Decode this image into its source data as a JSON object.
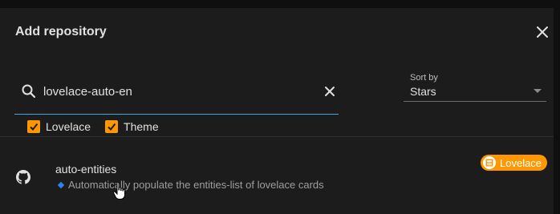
{
  "dialog": {
    "title": "Add repository",
    "close_icon": "close-icon"
  },
  "search": {
    "icon": "search-icon",
    "value": "lovelace-auto-en",
    "clear_icon": "close-icon"
  },
  "sort": {
    "label": "Sort by",
    "selected": "Stars"
  },
  "filters": [
    {
      "label": "Lovelace",
      "checked": true
    },
    {
      "label": "Theme",
      "checked": true
    }
  ],
  "results": [
    {
      "icon": "github-icon",
      "name": "auto-entities",
      "description": "Automatically populate the entities-list of lovelace cards",
      "badge": "Lovelace"
    }
  ],
  "colors": {
    "accent": "#ff9800",
    "focus_line": "#41a5e6",
    "background": "#1c1c1c"
  }
}
